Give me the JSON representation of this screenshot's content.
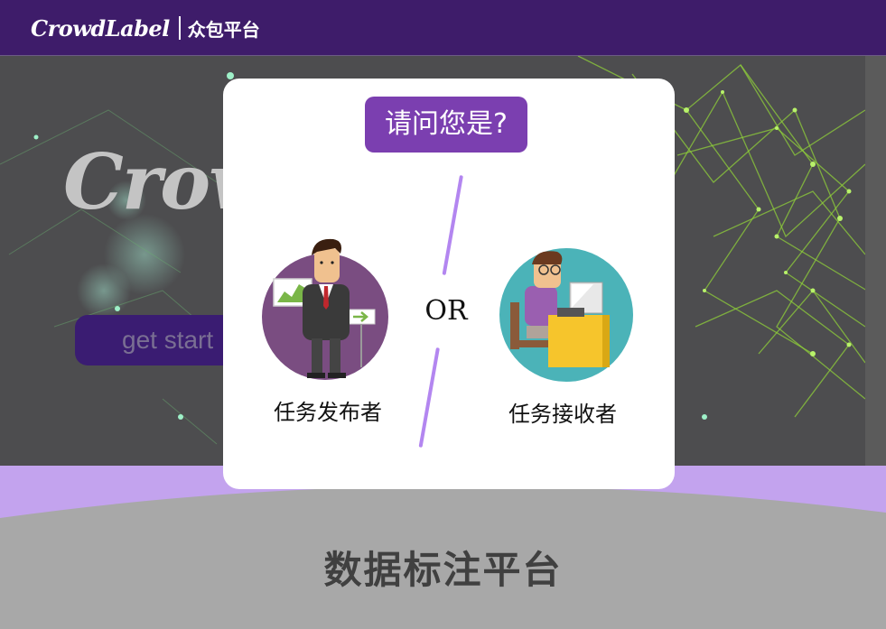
{
  "navbar": {
    "brand_name": "CrowdLabel",
    "brand_sub": "众包平台"
  },
  "hero": {
    "title": "Crowd",
    "cta_label": "get start"
  },
  "platform": {
    "title": "数据标注平台"
  },
  "modal": {
    "title": "请问您是?",
    "separator": "OR",
    "roles": [
      {
        "label": "任务发布者",
        "icon": "businessman-presentation-icon"
      },
      {
        "label": "任务接收者",
        "icon": "worker-computer-icon"
      }
    ]
  },
  "colors": {
    "navbar": "#3e1c6a",
    "accent": "#7b3fb0",
    "divider": "#b386f0",
    "band": "#c3a3ee"
  }
}
